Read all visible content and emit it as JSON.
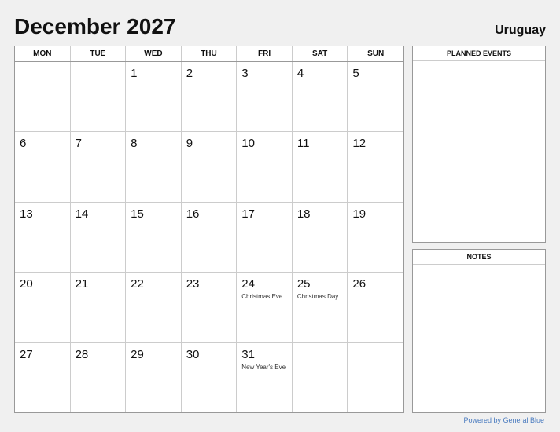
{
  "header": {
    "title": "December 2027",
    "country": "Uruguay"
  },
  "calendar": {
    "weekdays": [
      "MON",
      "TUE",
      "WED",
      "THU",
      "FRI",
      "SAT",
      "SUN"
    ],
    "rows": [
      [
        {
          "day": "",
          "empty": true
        },
        {
          "day": "",
          "empty": true
        },
        {
          "day": "1"
        },
        {
          "day": "2"
        },
        {
          "day": "3"
        },
        {
          "day": "4"
        },
        {
          "day": "5"
        }
      ],
      [
        {
          "day": "6"
        },
        {
          "day": "7"
        },
        {
          "day": "8"
        },
        {
          "day": "9"
        },
        {
          "day": "10"
        },
        {
          "day": "11"
        },
        {
          "day": "12"
        }
      ],
      [
        {
          "day": "13"
        },
        {
          "day": "14"
        },
        {
          "day": "15"
        },
        {
          "day": "16"
        },
        {
          "day": "17"
        },
        {
          "day": "18"
        },
        {
          "day": "19"
        }
      ],
      [
        {
          "day": "20"
        },
        {
          "day": "21"
        },
        {
          "day": "22"
        },
        {
          "day": "23"
        },
        {
          "day": "24",
          "event": "Christmas Eve"
        },
        {
          "day": "25",
          "event": "Christmas Day"
        },
        {
          "day": "26"
        }
      ],
      [
        {
          "day": "27"
        },
        {
          "day": "28"
        },
        {
          "day": "29"
        },
        {
          "day": "30"
        },
        {
          "day": "31",
          "event": "New Year's Eve"
        },
        {
          "day": "",
          "empty": true
        },
        {
          "day": "",
          "empty": true
        }
      ]
    ]
  },
  "sidebar": {
    "planned_events_label": "PLANNED EVENTS",
    "notes_label": "NOTES"
  },
  "footer": {
    "powered_by": "Powered by General Blue"
  }
}
